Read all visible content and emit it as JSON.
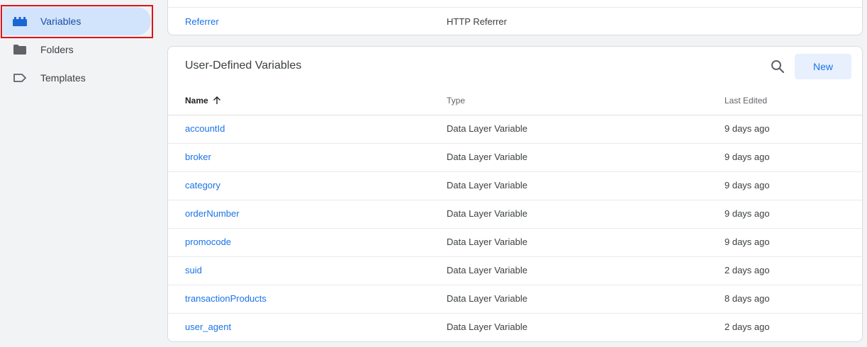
{
  "sidebar": {
    "items": [
      {
        "label": "Variables",
        "icon": "blocks-icon",
        "active": true
      },
      {
        "label": "Folders",
        "icon": "folder-icon",
        "active": false
      },
      {
        "label": "Templates",
        "icon": "label-icon",
        "active": false
      }
    ]
  },
  "builtin": {
    "row": {
      "name": "Referrer",
      "type": "HTTP Referrer"
    }
  },
  "user_defined": {
    "title": "User-Defined Variables",
    "new_label": "New",
    "columns": {
      "name": "Name",
      "type": "Type",
      "edited": "Last Edited"
    },
    "rows": [
      {
        "name": "accountId",
        "type": "Data Layer Variable",
        "edited": "9 days ago"
      },
      {
        "name": "broker",
        "type": "Data Layer Variable",
        "edited": "9 days ago"
      },
      {
        "name": "category",
        "type": "Data Layer Variable",
        "edited": "9 days ago"
      },
      {
        "name": "orderNumber",
        "type": "Data Layer Variable",
        "edited": "9 days ago"
      },
      {
        "name": "promocode",
        "type": "Data Layer Variable",
        "edited": "9 days ago"
      },
      {
        "name": "suid",
        "type": "Data Layer Variable",
        "edited": "2 days ago"
      },
      {
        "name": "transactionProducts",
        "type": "Data Layer Variable",
        "edited": "8 days ago"
      },
      {
        "name": "user_agent",
        "type": "Data Layer Variable",
        "edited": "2 days ago"
      }
    ]
  },
  "colors": {
    "accent": "#1a73e8",
    "active_bg": "#d2e3fc",
    "highlight": "#e0121b"
  }
}
